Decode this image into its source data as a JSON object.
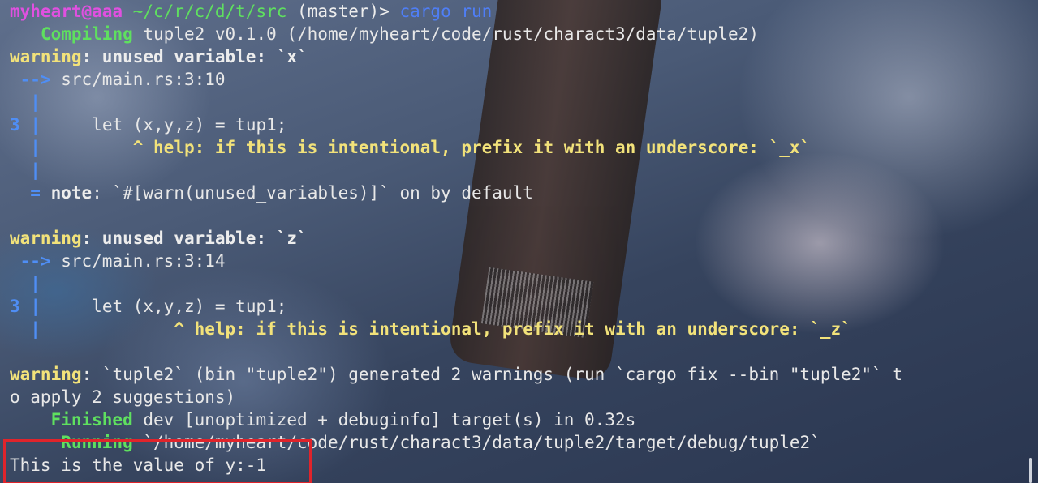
{
  "prompt": {
    "user_host": "myheart@aaa",
    "path": "~/c/r/c/d/t/src",
    "branch": "(master)>",
    "command": "cargo run"
  },
  "compile": {
    "verb": "Compiling",
    "rest": " tuple2 v0.1.0 (/home/myheart/code/rust/charact3/data/tuple2)"
  },
  "warning1": {
    "keyword": "warning",
    "message": ": unused variable: `x`",
    "arrow": "-->",
    "location": " src/main.rs:3:10",
    "line_no": "3",
    "code": "     let (x,y,z) = tup1;",
    "caret_pad": "         ",
    "help": "^ help: if this is intentional, prefix it with an underscore: `_x`",
    "note_eq": "=",
    "note_kw": "note",
    "note_text": ": `#[warn(unused_variables)]` on by default"
  },
  "warning2": {
    "keyword": "warning",
    "message": ": unused variable: `z`",
    "arrow": "-->",
    "location": " src/main.rs:3:14",
    "line_no": "3",
    "code": "     let (x,y,z) = tup1;",
    "caret_pad": "             ",
    "help": "^ help: if this is intentional, prefix it with an underscore: `_z`"
  },
  "summary": {
    "keyword": "warning",
    "line1": ": `tuple2` (bin \"tuple2\") generated 2 warnings (run `cargo fix --bin \"tuple2\"` t",
    "line2": "o apply 2 suggestions)"
  },
  "finished": {
    "verb": "Finished",
    "rest": " dev [unoptimized + debuginfo] target(s) in 0.32s"
  },
  "running": {
    "verb": "Running",
    "rest": " `/home/myheart/code/rust/charact3/data/tuple2/target/debug/tuple2`"
  },
  "output": {
    "text": "This is the value of y:-1"
  },
  "colors": {
    "highlight_box": "#e0242b",
    "green": "#5fe05f",
    "yellow": "#f2e27a",
    "blue": "#4f8ef5"
  }
}
